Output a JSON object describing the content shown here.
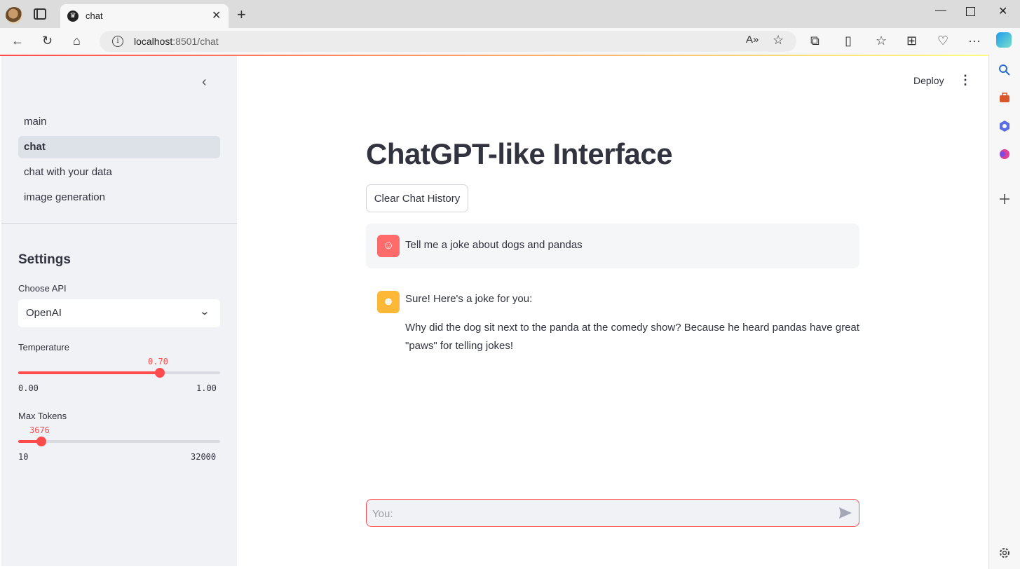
{
  "browser": {
    "tab_title": "chat",
    "url_host": "localhost",
    "url_path": ":8501/chat"
  },
  "sidebar": {
    "nav_items": [
      {
        "label": "main",
        "active": false
      },
      {
        "label": "chat",
        "active": true
      },
      {
        "label": "chat with your data",
        "active": false
      },
      {
        "label": "image generation",
        "active": false
      }
    ],
    "settings_title": "Settings",
    "api": {
      "label": "Choose API",
      "value": "OpenAI"
    },
    "temperature": {
      "label": "Temperature",
      "value": "0.70",
      "min": "0.00",
      "max": "1.00",
      "fraction": 0.7
    },
    "max_tokens": {
      "label": "Max Tokens",
      "value": "3676",
      "min": "10",
      "max": "32000",
      "fraction": 0.1147
    }
  },
  "header": {
    "deploy_label": "Deploy"
  },
  "main": {
    "title": "ChatGPT-like Interface",
    "clear_button": "Clear Chat History",
    "messages": [
      {
        "role": "user",
        "text": "Tell me a joke about dogs and pandas"
      },
      {
        "role": "assistant",
        "line1": "Sure! Here's a joke for you:",
        "line2": "Why did the dog sit next to the panda at the comedy show? Because he heard pandas have great",
        "line3": "\"paws\" for telling jokes!"
      }
    ],
    "input_placeholder": "You:"
  },
  "colors": {
    "accent": "#ff4b4b",
    "sidebar_bg": "#f0f2f6",
    "user_avatar": "#ff6b6b",
    "bot_avatar": "#fcb836"
  }
}
